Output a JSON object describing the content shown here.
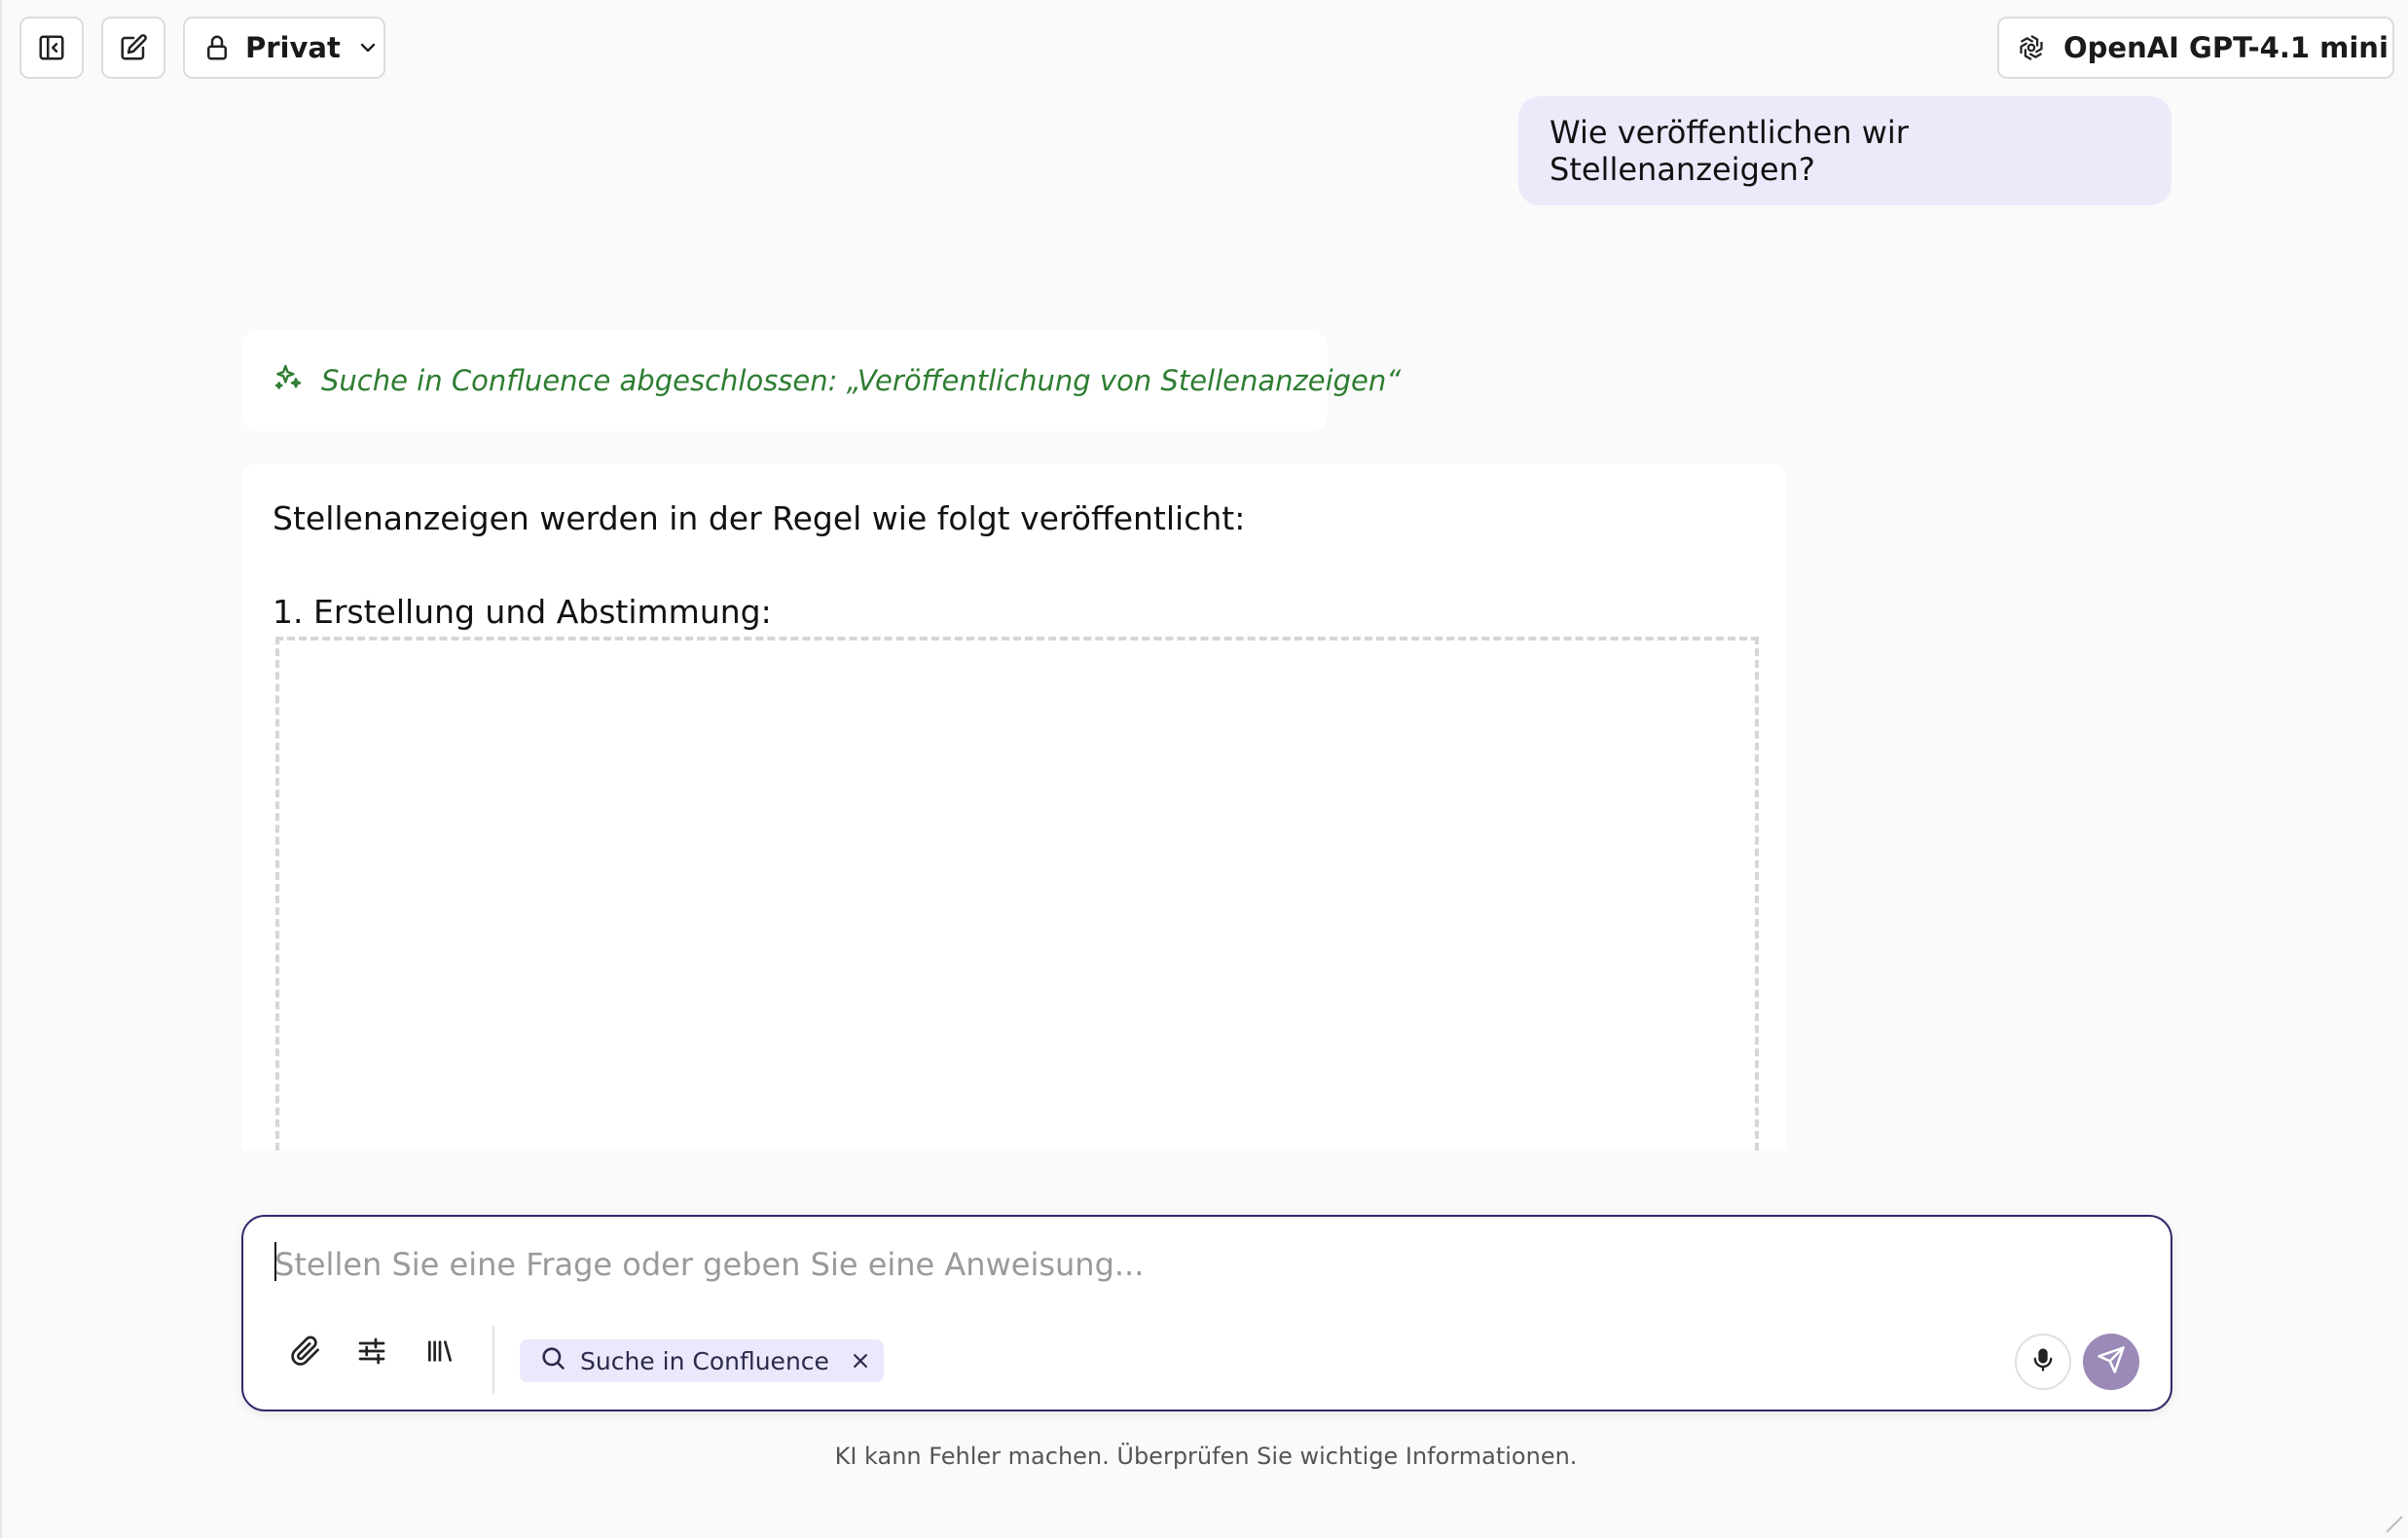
{
  "header": {
    "visibility_label": "Privat",
    "model_label": "OpenAI GPT-4.1 mini"
  },
  "conversation": {
    "user_message": "Wie veröffentlichen wir Stellenanzeigen?",
    "search_status": "Suche in Confluence abgeschlossen:  „Veröffentlichung von Stellenanzeigen“",
    "answer_intro": "Stellenanzeigen werden in der Regel wie folgt veröffentlicht:",
    "answer_step_1": "1. Erstellung und Abstimmung:"
  },
  "composer": {
    "placeholder": "Stellen Sie eine Frage oder geben Sie eine Anweisung...",
    "value": "",
    "active_tool_chip": "Suche in Confluence"
  },
  "footer": {
    "disclaimer": "KI kann Fehler machen. Überprüfen Sie wichtige Informationen."
  },
  "colors": {
    "accent": "#2f2a6b",
    "user_bubble": "#ebeafb",
    "status_green": "#2e7d32",
    "send_button": "#9b8ab8"
  },
  "icons": {
    "sidebar_toggle": "sidebar-collapse-icon",
    "new_chat": "edit-icon",
    "visibility": "lock-icon",
    "model": "openai-logo-icon",
    "status": "sparkles-icon",
    "attach": "paperclip-icon",
    "settings": "sliders-icon",
    "library": "library-icon",
    "chip_search": "search-icon",
    "chip_remove": "close-icon",
    "voice": "microphone-icon",
    "send": "send-icon"
  }
}
